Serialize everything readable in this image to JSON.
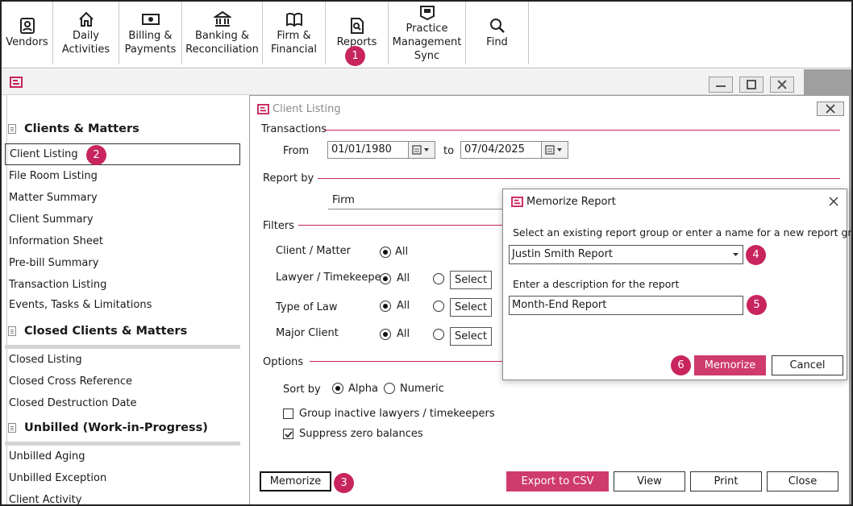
{
  "toolbar": {
    "items": [
      {
        "label": "Vendors",
        "icon": "vendor-contact-icon"
      },
      {
        "label": "Daily\nActivities",
        "icon": "home-icon"
      },
      {
        "label": "Billing &\nPayments",
        "icon": "money-icon"
      },
      {
        "label": "Banking &\nReconciliation",
        "icon": "bank-icon"
      },
      {
        "label": "Firm &\nFinancial",
        "icon": "book-icon"
      },
      {
        "label": "Reports",
        "icon": "report-search-icon"
      },
      {
        "label": "Practice\nManagement\nSync",
        "icon": "sync-book-icon"
      },
      {
        "label": "Find",
        "icon": "search-icon"
      }
    ]
  },
  "steps": {
    "one": "1",
    "two": "2",
    "three": "3",
    "four": "4",
    "five": "5",
    "six": "6"
  },
  "left_panel": {
    "sections": [
      {
        "title": "Clients & Matters",
        "items": [
          "Client Listing",
          "File Room Listing",
          "Matter Summary",
          "Client Summary",
          "Information Sheet",
          "Pre-bill Summary",
          "Transaction Listing",
          "Events, Tasks & Limitations"
        ]
      },
      {
        "title": "Closed Clients & Matters",
        "items": [
          "Closed Listing",
          "Closed Cross Reference",
          "Closed Destruction Date"
        ]
      },
      {
        "title": "Unbilled (Work-in-Progress)",
        "items": [
          "Unbilled Aging",
          "Unbilled Exception",
          "Client Activity"
        ]
      }
    ]
  },
  "client_listing": {
    "title": "Client Listing",
    "transactions": {
      "heading": "Transactions",
      "from_label": "From",
      "from_value": "01/01/1980",
      "to_label": "to",
      "to_value": "07/04/2025"
    },
    "report_by": {
      "heading": "Report by",
      "value": "Firm"
    },
    "filters": {
      "heading": "Filters",
      "all_label": "All",
      "select_label": "Select",
      "rows": [
        "Client / Matter",
        "Lawyer / Timekeeper",
        "Type of Law",
        "Major Client"
      ]
    },
    "options": {
      "heading": "Options",
      "sort_label": "Sort by",
      "sort_alpha": "Alpha",
      "sort_numeric": "Numeric",
      "group_inactive": "Group inactive lawyers / timekeepers",
      "suppress_zero": "Suppress zero balances"
    },
    "buttons": {
      "memorize": "Memorize",
      "export": "Export to CSV",
      "view": "View",
      "print": "Print",
      "close": "Close"
    }
  },
  "memorize_dialog": {
    "title": "Memorize Report",
    "instruction": "Select an existing report group or enter a name for a new report group",
    "group_value": "Justin Smith Report",
    "desc_label": "Enter a description for the report",
    "desc_value": "Month-End Report",
    "memorize_label": "Memorize",
    "cancel_label": "Cancel"
  },
  "colors": {
    "accent": "#c8245e",
    "button_primary": "#cf3b6c"
  }
}
